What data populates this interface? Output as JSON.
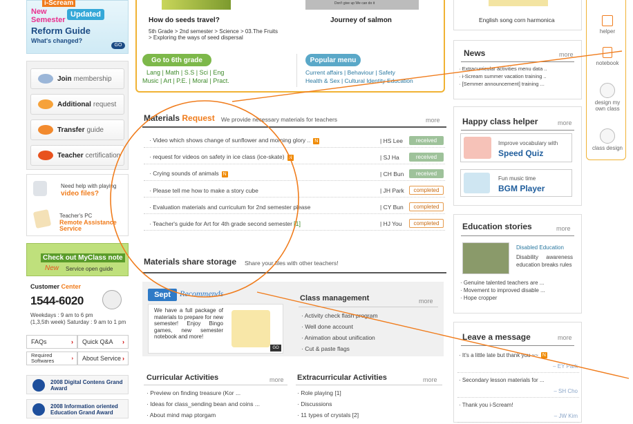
{
  "reform_guide": {
    "line1": "i-Scream",
    "line2": "New",
    "line3": "Semester",
    "badge": "Updated",
    "title": "Reform Guide",
    "sub": "What's changed?",
    "go": "GO"
  },
  "featured": {
    "item1_title": "How do seeds travel?",
    "item1_path": "5th Grade > 2nd semester > Science > 03.The Fruits > Exploring the ways of seed dispersal",
    "item2_title": "Journey of salmon",
    "item2_caption": "Don't give up   We can do it",
    "grade_btn": "Go to 6th grade",
    "popular_btn": "Popular menu",
    "subjects_row1": "Lang | Math | S.S | Sci | Eng",
    "subjects_row2": "Music | Art | P.E. | Moral | Pract.",
    "popular_row1": "Current affairs | Behaviour | Safety",
    "popular_row2": "Health & Sex | Cultural Identity Education"
  },
  "left": {
    "join": {
      "bold": "Join",
      "rest": "membership"
    },
    "additional": {
      "bold": "Additional",
      "rest": "request"
    },
    "transfer": {
      "bold": "Transfer",
      "rest": "guide"
    },
    "teacher": {
      "bold": "Teacher",
      "rest": "certification"
    },
    "video_help": "Need help with playing",
    "video_link": "video files?",
    "pc_label": "Teacher's PC",
    "pc_link1": "Remote Assistance",
    "pc_link2": "Service",
    "myclass_banner": "Check out MyClass note",
    "myclass_new": "New",
    "myclass_guide": "Service open guide",
    "customer": "Customer",
    "center": "Center",
    "phone": "1544-6020",
    "hours1": "Weekdays : 9 am to 6 pm",
    "hours2": "(1,3,5th week) Saturday : 9 am to 1 pm",
    "faqs": "FAQs",
    "quick_qa": "Quick Q&A",
    "required_sw": "Required Softwares",
    "about_service": "About Service",
    "award1": "2008 Digital Contens Grand Award",
    "award2": "2008 Information oriented Education Grand Award"
  },
  "materials": {
    "title1": "Materials",
    "title2": "Request",
    "subtitle": "We provide necessary materials for teachers",
    "more": "more",
    "rows": [
      {
        "title": "Video which shows change of sunflower and morning glory ..",
        "author": "| HS Lee",
        "status": "received"
      },
      {
        "title": "request for videos on safety in ice class (ice-skate)",
        "author": "| SJ Ha",
        "status": "received"
      },
      {
        "title": "Crying sounds of animals",
        "author": "| CH Bun",
        "status": "received"
      },
      {
        "title": "Please tell me how to make a story cube",
        "author": "| JH Park",
        "status": "completed"
      },
      {
        "title": "Evaluation materials and curriculum for 2nd semester please",
        "author": "| CY Bun",
        "status": "completed"
      },
      {
        "title": "Teacher's guide for Art for 4th grade second semester",
        "author": "| HJ You",
        "status": "completed"
      }
    ],
    "count_suffix": "[1]"
  },
  "share": {
    "title": "Materials share storage",
    "subtitle": "Share your files with other teachers!"
  },
  "sept": {
    "label": "Sept",
    "recommends": "Recommends",
    "text": "We have a full package of materials to prepare for new semester! Enjoy Bingo games, new semester notebook and more!",
    "go": "GO"
  },
  "class_mgmt": {
    "title": "Class management",
    "more": "more",
    "items": [
      "Activity check flash program",
      "Well done account",
      "Animation about unification",
      "Cut & paste flags"
    ]
  },
  "curricular": {
    "title": "Curricular Activities",
    "more": "more",
    "items": [
      "Preview on finding treasure (Kor ...",
      "Ideas for class_sending bean and coins ...",
      "About mind map ptorgam"
    ]
  },
  "extra": {
    "title": "Extracurricular Activities",
    "more": "more",
    "items": [
      "Role playing [1]",
      "Discussions",
      "11 types of crystals [2]"
    ]
  },
  "right": {
    "song": "English song corn harmonica",
    "news_title": "News",
    "news_more": "more",
    "news": [
      "Extracurricular activities menu data ..",
      "i-Scream summer vacation training ..",
      "[Semmer announcement] training ..."
    ],
    "helper_title": "Happy class helper",
    "helper_more": "more",
    "quiz_sub": "Improve vocabulary with",
    "quiz_title": "Speed Quiz",
    "bgm_sub": "Fun music time",
    "bgm_title": "BGM Player",
    "edu_title": "Education stories",
    "edu_more": "more",
    "edu_feature_title": "Disabled Education",
    "edu_feature_text": "Disability awareness education breaks rules",
    "edu_items": [
      "Genuine talented teachers are ...",
      "Movement to improved disable ...",
      "Hope cropper"
    ],
    "msg_title": "Leave a message",
    "msg_more": "more",
    "messages": [
      {
        "text": "It's a little late but thank you ~~",
        "author": "– EY Park"
      },
      {
        "text": "Secondary lesson materials for ...",
        "author": "– SH Cho"
      },
      {
        "text": "Thank you i-Scream!",
        "author": "– JW Kim"
      }
    ]
  },
  "side": {
    "helper": "helper",
    "notebook": "notebook",
    "design": "design my own class",
    "class_design": "class design"
  }
}
